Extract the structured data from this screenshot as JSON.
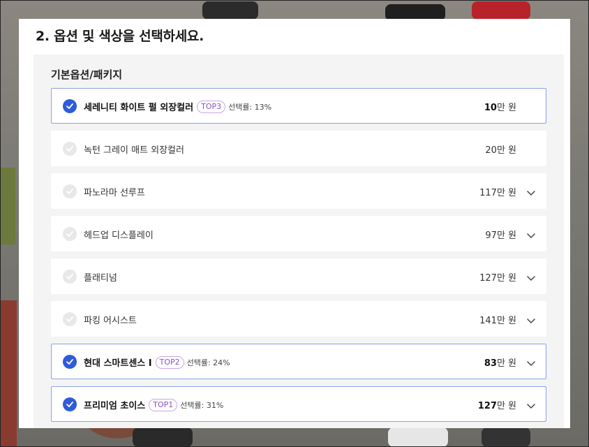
{
  "section_title": "2. 옵션 및 색상을 선택하세요.",
  "panel_title": "기본옵션/패키지",
  "currency_unit": "만 원",
  "colors": {
    "accent": "#2e5bd9",
    "badge": "#8e4fcb",
    "selected_border": "#8aa3e6"
  },
  "options": [
    {
      "name": "세레니티 화이트 펄 외장컬러",
      "badge": "TOP3",
      "rate": "선택률: 13%",
      "price": "10",
      "selected": true,
      "expandable": false
    },
    {
      "name": "녹턴 그레이 매트 외장컬러",
      "badge": "",
      "rate": "",
      "price": "20",
      "selected": false,
      "expandable": false
    },
    {
      "name": "파노라마 선루프",
      "badge": "",
      "rate": "",
      "price": "117",
      "selected": false,
      "expandable": true
    },
    {
      "name": "헤드업 디스플레이",
      "badge": "",
      "rate": "",
      "price": "97",
      "selected": false,
      "expandable": true
    },
    {
      "name": "플래티넘",
      "badge": "",
      "rate": "",
      "price": "127",
      "selected": false,
      "expandable": true
    },
    {
      "name": "파킹 어시스트",
      "badge": "",
      "rate": "",
      "price": "141",
      "selected": false,
      "expandable": true
    },
    {
      "name": "현대 스마트센스 I",
      "badge": "TOP2",
      "rate": "선택률: 24%",
      "price": "83",
      "selected": true,
      "expandable": true
    },
    {
      "name": "프리미엄 초이스",
      "badge": "TOP1",
      "rate": "선택률: 31%",
      "price": "127",
      "selected": true,
      "expandable": true
    }
  ]
}
